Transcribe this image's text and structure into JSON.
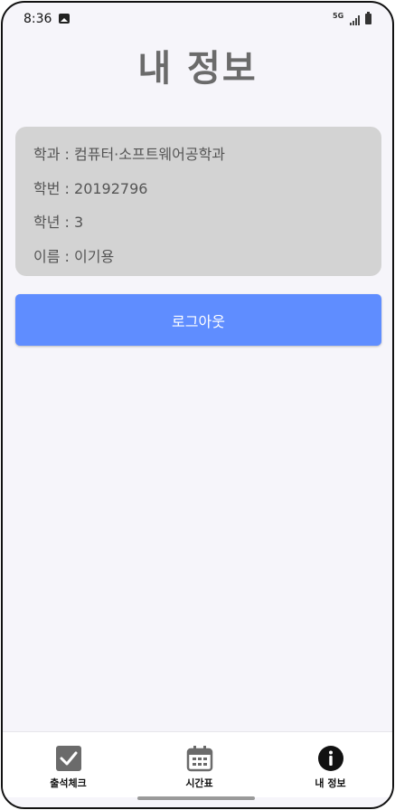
{
  "status_bar": {
    "time": "8:36",
    "network": "5G",
    "icons": [
      "gallery-icon",
      "signal-icon",
      "battery-icon"
    ]
  },
  "page": {
    "title": "내 정보"
  },
  "info": {
    "separator": " : ",
    "department_label": "학과",
    "department_value": "컴퓨터·소프트웨어공학과",
    "student_id_label": "학번",
    "student_id_value": "20192796",
    "grade_label": "학년",
    "grade_value": "3",
    "name_label": "이름",
    "name_value": "이기용"
  },
  "logout_label": "로그아웃",
  "nav": {
    "items": [
      {
        "label": "출석체크",
        "icon": "check-icon"
      },
      {
        "label": "시간표",
        "icon": "calendar-icon"
      },
      {
        "label": "내 정보",
        "icon": "info-icon"
      }
    ]
  },
  "colors": {
    "background": "#f6f5fa",
    "card": "#d3d3d3",
    "accent": "#5f8dff",
    "title": "#6b6b6b"
  }
}
